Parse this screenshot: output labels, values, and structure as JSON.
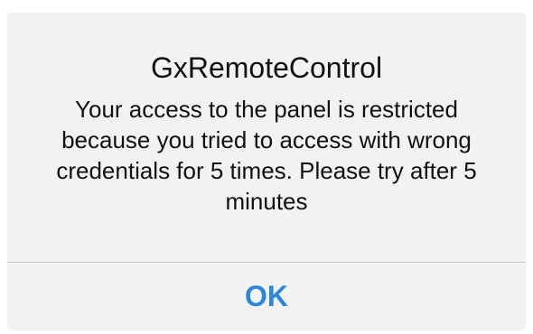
{
  "alert": {
    "title": "GxRemoteControl",
    "message": "Your access to the panel is restricted because you tried to access with wrong credentials for 5 times. Please try after 5 minutes",
    "button_label": "OK"
  },
  "colors": {
    "background": "#f2f2f2",
    "text": "#111111",
    "accent": "#2f87dc",
    "divider": "#c8c8cc"
  }
}
